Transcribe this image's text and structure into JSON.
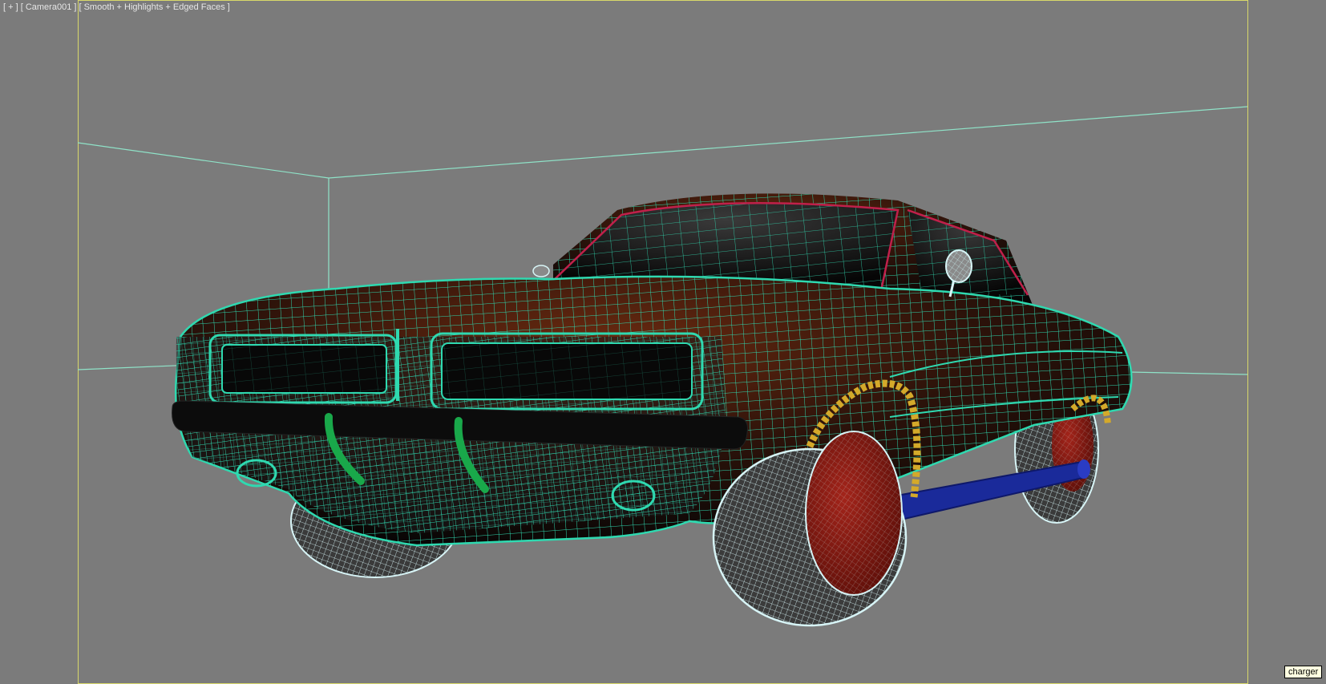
{
  "viewport": {
    "menu_label": "[ + ]",
    "camera_label": "[ Camera001 ]",
    "shading_label": "[ Smooth + Highlights + Edged Faces ]"
  },
  "tooltip": {
    "text": "charger"
  },
  "colors": {
    "background": "#7b7b7b",
    "safe_frame": "#d8d86a",
    "wireframe_body": "#2fd9b0",
    "wireframe_tire": "#cfeff3",
    "wheel_rim": "#8b1a12",
    "fender_flare": "#d4a92a",
    "side_exhaust": "#1a2a9a",
    "bumper_guard": "#19a84a",
    "window_trim": "#c0204a"
  },
  "icons": [
    "mirror-icon"
  ]
}
